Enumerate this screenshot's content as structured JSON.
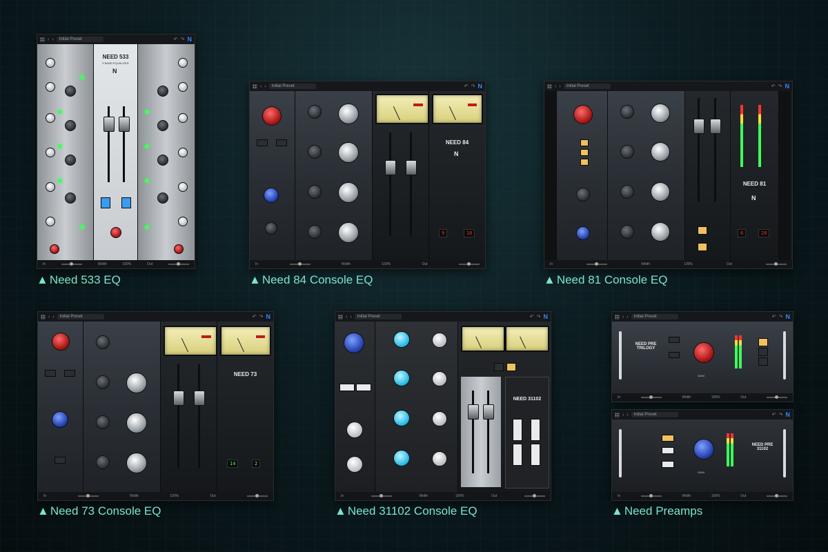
{
  "plugins": {
    "need533": {
      "caption": "Need 533 EQ",
      "preset": "Initial Preset",
      "brand": "NEED 533",
      "brand_sub": "5 BAND EQUALIZER",
      "footer_in": "In",
      "footer_width": "Width",
      "footer_pct": "100%",
      "footer_out": "Out"
    },
    "need84": {
      "caption": "Need 84 Console EQ",
      "preset": "Initial Preset",
      "brand": "NEED 84",
      "display_left": "9",
      "display_right": "16",
      "footer_in": "In",
      "footer_width": "Width",
      "footer_pct": "100%",
      "footer_out": "Out"
    },
    "need81": {
      "caption": "Need 81 Console EQ",
      "preset": "Initial Preset",
      "brand": "NEED 81",
      "display_left": "6",
      "display_right": "20",
      "footer_in": "In",
      "footer_width": "Width",
      "footer_pct": "100%",
      "footer_out": "Out"
    },
    "need73": {
      "caption": "Need 73 Console EQ",
      "preset": "Initial Preset",
      "brand": "NEED 73",
      "display_left": "14",
      "display_right": "2",
      "footer_in": "In",
      "footer_width": "Width",
      "footer_pct": "100%",
      "footer_out": "Out"
    },
    "need31102": {
      "caption": "Need 31102 Console EQ",
      "preset": "Initial Preset",
      "brand": "NEED 31102",
      "footer_in": "In",
      "footer_width": "Width",
      "footer_pct": "100%",
      "footer_out": "Out"
    },
    "preamp_trilogy": {
      "preset": "Initial Preset",
      "brand": "NEED PRE TRILOGY",
      "knob_label": "GAIN",
      "footer_in": "In",
      "footer_width": "Width",
      "footer_pct": "100%",
      "footer_out": "Out"
    },
    "preamp_31102": {
      "preset": "Initial Preset",
      "brand": "NEED PRE 31102",
      "knob_label": "GAIN",
      "footer_in": "In",
      "footer_width": "Width",
      "footer_pct": "100%",
      "footer_out": "Out"
    },
    "preamps_caption": "Need Preamps"
  },
  "colors": {
    "caption": "#7de3c9",
    "logo": "#2e8bff",
    "led_green": "#3eff5a",
    "led_red": "#ff2a2a"
  },
  "icons": [
    "grid-icon",
    "back-arrow-icon",
    "forward-arrow-icon",
    "undo-icon",
    "redo-icon",
    "need-logo-icon",
    "caption-triangle-icon"
  ]
}
